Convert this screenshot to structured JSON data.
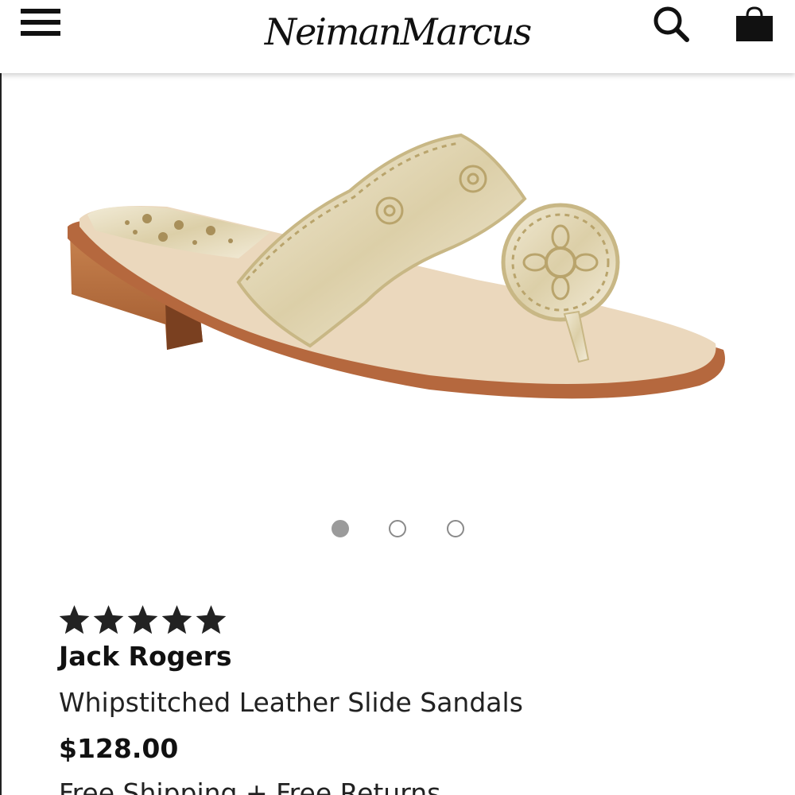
{
  "header": {
    "logo_text": "NeimanMarcus",
    "menu_icon": "hamburger-menu-icon",
    "search_icon": "search-icon",
    "bag_icon": "shopping-bag-icon"
  },
  "product_image": {
    "subject": "sandal-image",
    "carousel": {
      "count": 3,
      "active_index": 0
    }
  },
  "product": {
    "rating": 5,
    "rating_max": 5,
    "brand": "Jack Rogers",
    "name": "Whipstitched Leather Slide Sandals",
    "price": "$128.00",
    "shipping": "Free Shipping + Free Returns"
  },
  "colors": {
    "text": "#111111",
    "dot_active": "#9b9b9b",
    "dot_inactive_border": "#8a8a8a",
    "sandal_gold": "#e6ddc2",
    "sole_brown": "#b5683e"
  }
}
